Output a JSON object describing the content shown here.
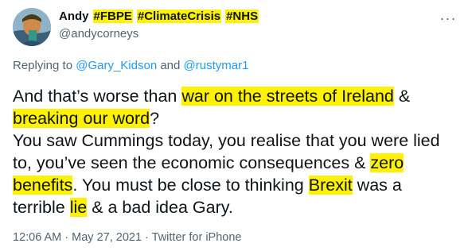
{
  "tweet": {
    "display_name": "Andy",
    "hashtags": [
      "#FBPE",
      "#ClimateCrisis",
      "#NHS"
    ],
    "handle": "@andycorneys",
    "more_icon": "more-icon",
    "replying_prefix": "Replying to ",
    "reply_user_1": "@Gary_Kidson",
    "reply_and": " and ",
    "reply_user_2": "@rustymar1",
    "text": {
      "p1": "And that’s worse than ",
      "h1": "war on the streets of Ireland",
      "p2": " & ",
      "h2": "breaking our word",
      "p3": "?",
      "p4": "You saw Cummings today, you realise that you were lied to, you’ve seen the economic consequences & ",
      "h3": "zero benefits",
      "p5": ". You must be close to thinking ",
      "h4": "Brexit",
      "p6": " was a terrible ",
      "h5": "lie",
      "p7": " & a bad idea Gary."
    },
    "time": "12:06 AM",
    "sep": " · ",
    "date": "May 27, 2021",
    "source": "Twitter for iPhone",
    "highlight_color": "#fff200",
    "link_color": "#1d9bf0"
  }
}
